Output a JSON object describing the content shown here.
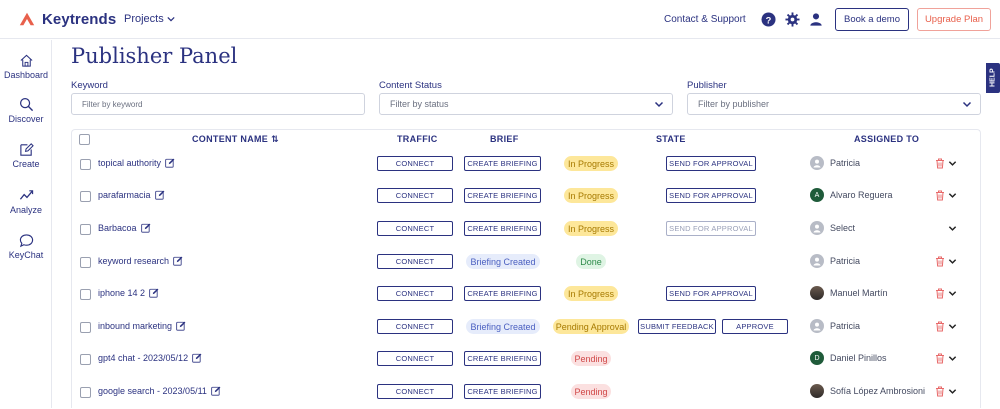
{
  "header": {
    "brand": "Keytrends",
    "projects_label": "Projects",
    "contact": "Contact & Support",
    "icons": [
      "help-circle-icon",
      "gear-icon",
      "user-icon"
    ],
    "book_demo": "Book a demo",
    "upgrade": "Upgrade Plan",
    "brand_color": "#2b3280",
    "accent_color": "#e8604c"
  },
  "sidebar": {
    "items": [
      {
        "label": "Dashboard",
        "icon": "home-icon"
      },
      {
        "label": "Discover",
        "icon": "search-icon"
      },
      {
        "label": "Create",
        "icon": "edit-icon"
      },
      {
        "label": "Analyze",
        "icon": "trend-icon"
      },
      {
        "label": "KeyChat",
        "icon": "chat-icon"
      }
    ]
  },
  "page": {
    "title": "Publisher Panel",
    "help": "HELP"
  },
  "filters": {
    "keyword_label": "Keyword",
    "keyword_placeholder": "Filter by keyword",
    "status_label": "Content Status",
    "status_placeholder": "Filter by status",
    "publisher_label": "Publisher",
    "publisher_placeholder": "Filter by publisher"
  },
  "table": {
    "headers": {
      "content_name": "CONTENT NAME",
      "sort_icon": "⇅",
      "traffic": "TRAFFIC",
      "brief": "BRIEF",
      "state": "STATE",
      "assigned_to": "ASSIGNED TO"
    },
    "rows": [
      {
        "name": "topical authority",
        "traffic": "CONNECT",
        "brief_type": "button",
        "brief": "CREATE BRIEFING",
        "state": "In Progress",
        "state_kind": "progress",
        "actions": [
          {
            "label": "SEND FOR APPROVAL",
            "enabled": true
          }
        ],
        "assignee": "Patricia",
        "avatar": "placeholder",
        "avatar_letter": "",
        "trash": true
      },
      {
        "name": "parafarmacia",
        "traffic": "CONNECT",
        "brief_type": "button",
        "brief": "CREATE BRIEFING",
        "state": "In Progress",
        "state_kind": "progress",
        "actions": [
          {
            "label": "SEND FOR APPROVAL",
            "enabled": true
          }
        ],
        "assignee": "Alvaro Reguera",
        "avatar": "letter",
        "avatar_letter": "A",
        "trash": true
      },
      {
        "name": "Barbacoa",
        "traffic": "CONNECT",
        "brief_type": "button",
        "brief": "CREATE BRIEFING",
        "state": "In Progress",
        "state_kind": "progress",
        "actions": [
          {
            "label": "SEND FOR APPROVAL",
            "enabled": false
          }
        ],
        "assignee": "Select",
        "avatar": "placeholder",
        "avatar_letter": "",
        "trash": false
      },
      {
        "name": "keyword research",
        "traffic": "CONNECT",
        "brief_type": "tag",
        "brief": "Briefing Created",
        "state": "Done",
        "state_kind": "done",
        "actions": [],
        "assignee": "Patricia",
        "avatar": "placeholder",
        "avatar_letter": "",
        "trash": true
      },
      {
        "name": "iphone 14 2",
        "traffic": "CONNECT",
        "brief_type": "button",
        "brief": "CREATE BRIEFING",
        "state": "In Progress",
        "state_kind": "progress",
        "actions": [
          {
            "label": "SEND FOR APPROVAL",
            "enabled": true
          }
        ],
        "assignee": "Manuel Martín",
        "avatar": "photo",
        "avatar_letter": "",
        "trash": true
      },
      {
        "name": "inbound marketing",
        "traffic": "CONNECT",
        "brief_type": "tag",
        "brief": "Briefing Created",
        "state": "Pending Approval",
        "state_kind": "approval",
        "actions": [
          {
            "label": "SUBMIT FEEDBACK",
            "enabled": true
          },
          {
            "label": "APPROVE",
            "enabled": true
          }
        ],
        "assignee": "Patricia",
        "avatar": "placeholder",
        "avatar_letter": "",
        "trash": true
      },
      {
        "name": "gpt4 chat - 2023/05/12",
        "traffic": "CONNECT",
        "brief_type": "button",
        "brief": "CREATE BRIEFING",
        "state": "Pending",
        "state_kind": "pending",
        "actions": [],
        "assignee": "Daniel Pinillos",
        "avatar": "letter",
        "avatar_letter": "D",
        "trash": true
      },
      {
        "name": "google search - 2023/05/11",
        "traffic": "CONNECT",
        "brief_type": "button",
        "brief": "CREATE BRIEFING",
        "state": "Pending",
        "state_kind": "pending",
        "actions": [],
        "assignee": "Sofía López Ambrosioni",
        "avatar": "photo",
        "avatar_letter": "",
        "trash": true
      }
    ]
  },
  "colors": {
    "progress_bg": "#fde79a",
    "progress_fg": "#a77a00",
    "done_bg": "#dff4e4",
    "done_fg": "#2e8b4a",
    "approval_bg": "#fde79a",
    "approval_fg": "#a77a00",
    "pending_bg": "#fbe0e0",
    "pending_fg": "#d04848",
    "brief_tag_bg": "#e6ecfb",
    "brief_tag_fg": "#4a5fc0",
    "avatar_green": "#1f5b3a",
    "trash": "#e86a6a"
  }
}
